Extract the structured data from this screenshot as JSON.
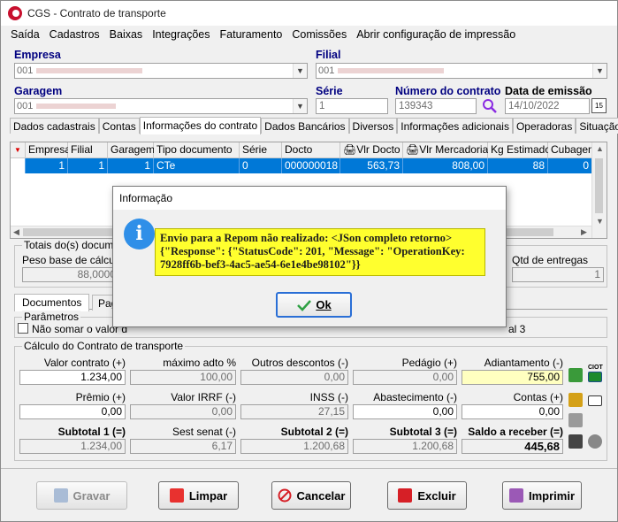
{
  "window": {
    "title": "CGS - Contrato de transporte"
  },
  "menu": [
    "Saída",
    "Cadastros",
    "Baixas",
    "Integrações",
    "Faturamento",
    "Comissões",
    "Abrir configuração de impressão"
  ],
  "header": {
    "empresa_label": "Empresa",
    "empresa_value": "001",
    "filial_label": "Filial",
    "filial_value": "001",
    "garagem_label": "Garagem",
    "garagem_value": "001",
    "serie_label": "Série",
    "serie_value": "1",
    "numero_label": "Número do contrato",
    "numero_value": "139343",
    "data_label": "Data de emissão",
    "data_value": "14/10/2022"
  },
  "tabs": [
    "Dados cadastrais",
    "Contas",
    "Informações do contrato",
    "Dados Bancários",
    "Diversos",
    "Informações adicionais",
    "Operadoras",
    "Situação"
  ],
  "grid": {
    "headers": [
      "Empresa",
      "Filial",
      "Garagem",
      "Tipo documento",
      "Série",
      "Docto",
      "Vlr Docto",
      "Vlr Mercadoria",
      "Kg Estimado",
      "Cubagem"
    ],
    "row": [
      "1",
      "1",
      "1",
      "CTe",
      "0",
      "000000018",
      "563,73",
      "808,00",
      "88",
      "0"
    ]
  },
  "totais": {
    "title": "Totais do(s) documento",
    "peso_label": "Peso base de cálculo",
    "peso_value": "88,0000",
    "qtd_label": "Qtd de entregas",
    "qtd_value": "1"
  },
  "lower_tabs": [
    "Documentos",
    "Pag"
  ],
  "parametros": {
    "title": "Parâmetros",
    "checkbox_label": "Não somar o valor d",
    "right_text": "al 3"
  },
  "calculo": {
    "title": "Cálculo do Contrato de transporte",
    "row1": [
      {
        "label": "Valor contrato (+)",
        "value": "1.234,00"
      },
      {
        "label": "máximo adto %",
        "value": "100,00"
      },
      {
        "label": "Outros descontos (-)",
        "value": "0,00"
      },
      {
        "label": "Pedágio (+)",
        "value": "0,00"
      },
      {
        "label": "Adiantamento (-)",
        "value": "755,00"
      }
    ],
    "row2": [
      {
        "label": "Prêmio (+)",
        "value": "0,00"
      },
      {
        "label": "Valor IRRF (-)",
        "value": "0,00"
      },
      {
        "label": "INSS (-)",
        "value": "27,15"
      },
      {
        "label": "Abastecimento (-)",
        "value": "0,00"
      },
      {
        "label": "Contas (+)",
        "value": "0,00"
      }
    ],
    "row3": [
      {
        "label": "Subtotal 1 (=)",
        "value": "1.234,00"
      },
      {
        "label": "Sest senat (-)",
        "value": "6,17"
      },
      {
        "label": "Subtotal 2 (=)",
        "value": "1.200,68"
      },
      {
        "label": "Subtotal 3 (=)",
        "value": "1.200,68"
      },
      {
        "label": "Saldo a receber (=)",
        "value": "445,68"
      }
    ],
    "ciot_label": "CIOT"
  },
  "buttons": {
    "gravar": "Gravar",
    "limpar": "Limpar",
    "cancelar": "Cancelar",
    "excluir": "Excluir",
    "imprimir": "Imprimir"
  },
  "dialog": {
    "title": "Informação",
    "line1": "Envio para a Repom não realizado: <JSon completo retorno>",
    "line2": "{\"Response\": {\"StatusCode\": 201, \"Message\": \"OperationKey:",
    "line3": "7928ff6b-bef3-4ac5-ae54-6e1e4be98102\"}}",
    "ok": "Ok"
  },
  "colors": {
    "accent": "#0078d7",
    "label_blue": "#000080",
    "message_bg": "#ffff2e",
    "info_icon": "#2f8fe8"
  }
}
